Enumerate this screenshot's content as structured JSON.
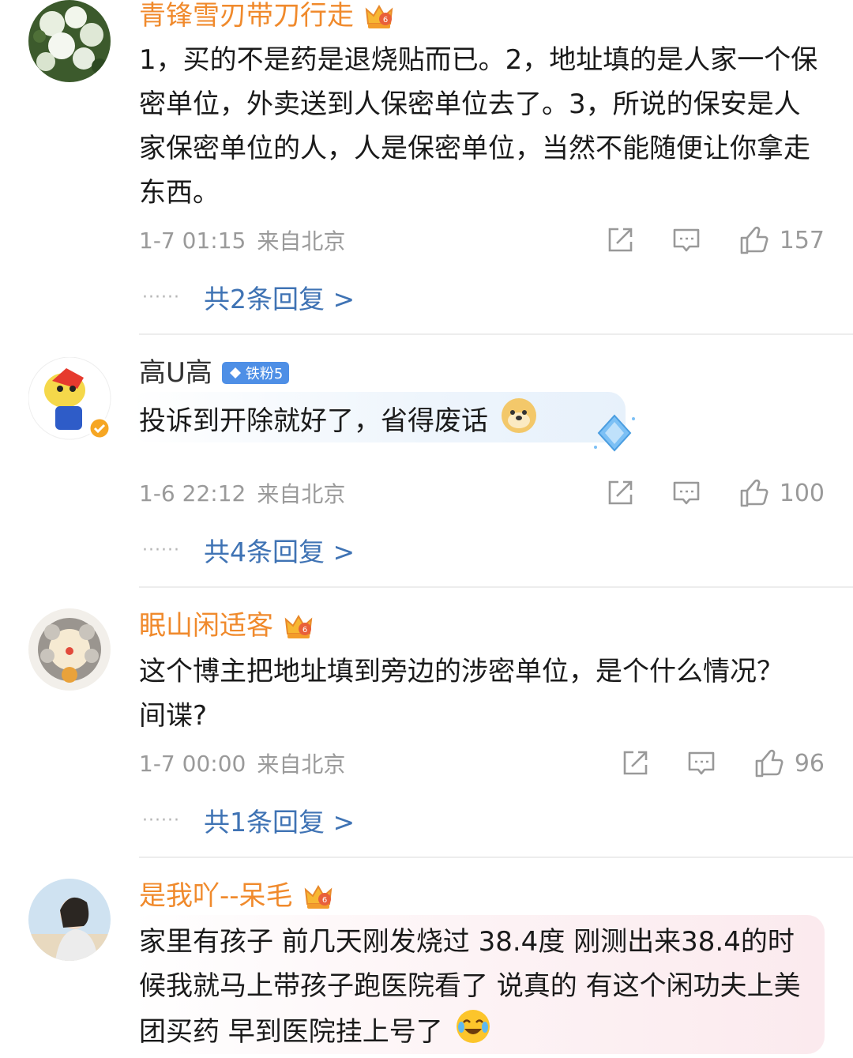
{
  "comments": [
    {
      "user": "青锋雪刃带刀行走",
      "text": "1，买的不是药是退烧贴而已。2，地址填的是人家一个保密单位，外卖送到人保密单位去了。3，所说的保安是人家保密单位的人，人是保密单位，当然不能随便让你拿走东西。",
      "time": "1-7 01:15",
      "location": "来自北京",
      "likes": "157",
      "replies_label": "共2条回复 >"
    },
    {
      "user": "高U高",
      "badge": "铁粉5",
      "text": "投诉到开除就好了，省得废话",
      "time": "1-6 22:12",
      "location": "来自北京",
      "likes": "100",
      "replies_label": "共4条回复 >"
    },
    {
      "user": "眠山闲适客",
      "text": "这个博主把地址填到旁边的涉密单位，是个什么情况？间谍?",
      "time": "1-7 00:00",
      "location": "来自北京",
      "likes": "96",
      "replies_label": "共1条回复 >"
    },
    {
      "user": "是我吖--呆毛",
      "text": "家里有孩子 前几天刚发烧过 38.4度 刚测出来38.4的时候我就马上带孩子跑医院看了 说真的 有这个闲功夫上美团买药 早到医院挂上号了"
    }
  ],
  "colors": {
    "username_vip": "#f08a2c",
    "reply_link": "#3f73b4",
    "meta_gray": "#9a9a9a",
    "badge_blue": "#4e8fe6"
  },
  "icons": [
    "share-icon",
    "comment-icon",
    "like-icon",
    "crown-icon",
    "diamond-icon",
    "verified-icon"
  ]
}
